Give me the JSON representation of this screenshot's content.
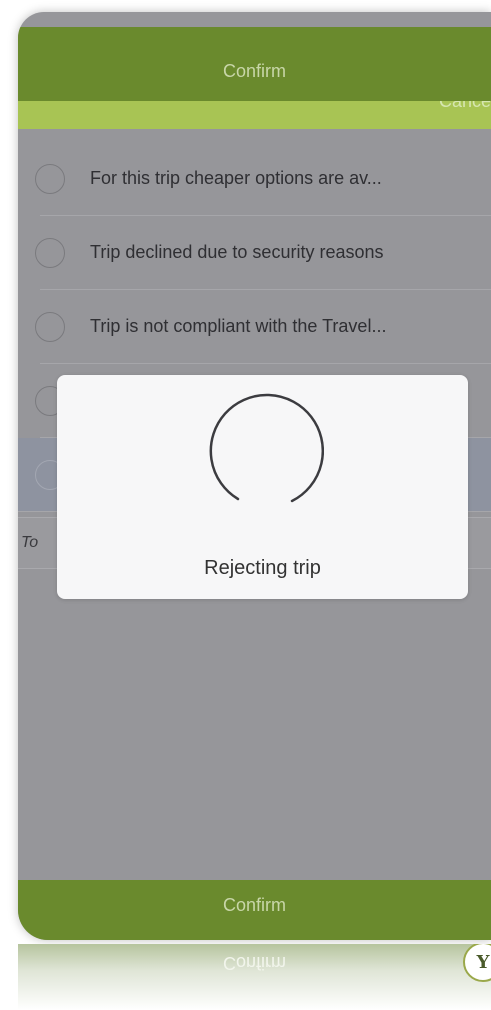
{
  "header": {
    "confirm_label": "Confirm",
    "cancel_label": "Cancel"
  },
  "reasons": [
    {
      "label": "For this trip cheaper options are av..."
    },
    {
      "label": "Trip declined due to security reasons"
    },
    {
      "label": "Trip is not compliant with the Travel..."
    },
    {
      "label": ""
    },
    {
      "label": ""
    }
  ],
  "comment": {
    "placeholder": "To"
  },
  "loading": {
    "message": "Rejecting trip"
  },
  "footer": {
    "confirm_label": "Confirm"
  },
  "reflection": {
    "confirm_label": "Confirm",
    "badge_letter": "Y"
  },
  "colors": {
    "bar": "#6a8a2d",
    "sub_bar": "#a8c454",
    "overlay": "#96969a",
    "hud": "#f7f7f8"
  }
}
